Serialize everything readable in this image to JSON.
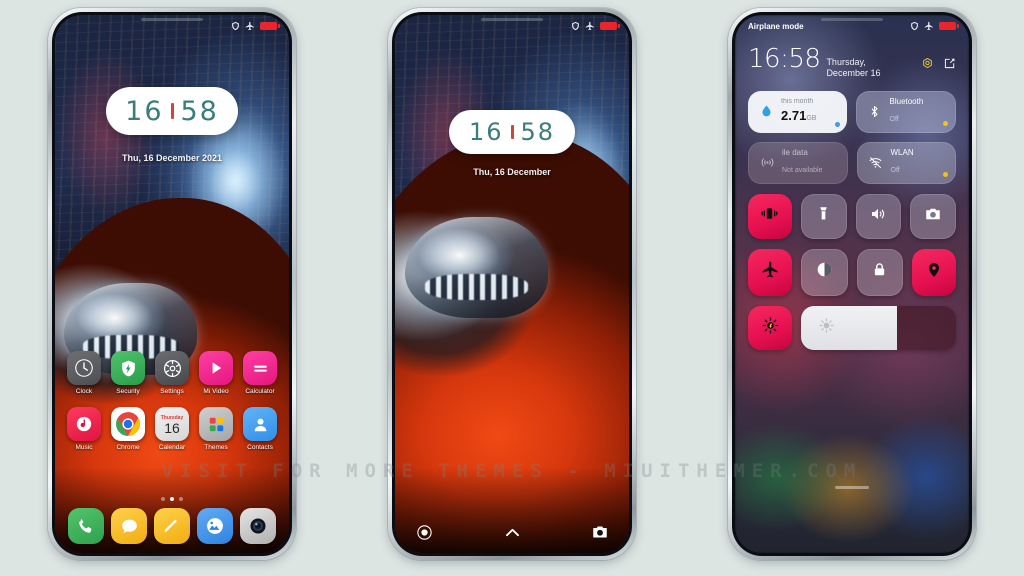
{
  "meta": {
    "background_color": "#dde5e3",
    "accent_pink": "#e61050",
    "clock_teal": "#3b7c7c",
    "clock_sep_red": "#d0453a",
    "watermark": "VISIT FOR MORE THEMES - MIUITHEMER.COM"
  },
  "phone1": {
    "label": "home-screen",
    "statusbar": {
      "shield_icon": "shield-icon",
      "airplane_icon": "airplane-icon",
      "battery_icon": "battery-icon"
    },
    "clock": {
      "hours": "16",
      "minutes": "58"
    },
    "date": "Thu, 16 December 2021",
    "apps_row1": [
      {
        "label": "Clock",
        "icon": "clock-icon"
      },
      {
        "label": "Security",
        "icon": "shield-icon"
      },
      {
        "label": "Settings",
        "icon": "gear-icon"
      },
      {
        "label": "Mi Video",
        "icon": "play-icon"
      },
      {
        "label": "Calculator",
        "icon": "equals-icon"
      }
    ],
    "apps_row2": [
      {
        "label": "Music",
        "icon": "music-note-icon"
      },
      {
        "label": "Chrome",
        "icon": "chrome-icon"
      },
      {
        "label": "Calendar",
        "icon": "calendar-icon",
        "weekday": "Thursday",
        "day": "16"
      },
      {
        "label": "Themes",
        "icon": "themes-grid-icon"
      },
      {
        "label": "Contacts",
        "icon": "person-icon"
      }
    ],
    "dock": [
      {
        "label": "Phone",
        "icon": "phone-icon"
      },
      {
        "label": "Messages",
        "icon": "message-bubble-icon"
      },
      {
        "label": "Notes",
        "icon": "pencil-icon"
      },
      {
        "label": "Gallery",
        "icon": "photo-icon"
      },
      {
        "label": "Camera",
        "icon": "camera-icon"
      }
    ],
    "page_dots": {
      "count": 3,
      "active_index": 1
    }
  },
  "phone2": {
    "label": "lock-screen",
    "statusbar": {
      "shield_icon": "shield-icon",
      "airplane_icon": "airplane-icon",
      "battery_icon": "battery-icon"
    },
    "clock": {
      "hours": "16",
      "minutes": "58"
    },
    "date": "Thu, 16 December",
    "bottom_bar": [
      {
        "name": "flashlight-button",
        "icon": "circle-dot-icon"
      },
      {
        "name": "unlock-chevron",
        "icon": "chevron-up-icon"
      },
      {
        "name": "camera-button",
        "icon": "camera-icon"
      }
    ]
  },
  "phone3": {
    "label": "control-center",
    "statusbar": {
      "left_text": "Airplane mode",
      "shield_icon": "shield-icon",
      "airplane_icon": "airplane-icon",
      "battery_icon": "battery-icon"
    },
    "clock": "16:58",
    "date": "Thursday, December 16",
    "header_icons": [
      {
        "name": "settings-gear-icon",
        "icon": "gear-icon"
      },
      {
        "name": "edit-tiles-icon",
        "icon": "edit-square-icon"
      }
    ],
    "tiles_row1": [
      {
        "name": "data-usage-tile",
        "style": "light",
        "icon": "water-drop-icon",
        "title": "this month",
        "value": "2.71",
        "unit": "GB",
        "dot_color": "#3c9ae8"
      },
      {
        "name": "bluetooth-tile",
        "style": "glass",
        "icon": "bluetooth-icon",
        "title": "Bluetooth",
        "sub": "Off",
        "dot_color": "#f0c419"
      }
    ],
    "tiles_row2": [
      {
        "name": "mobile-data-tile",
        "style": "dim",
        "icon": "signal-icon",
        "title": "ile data",
        "sub": "Not available",
        "dot_color": ""
      },
      {
        "name": "wlan-tile",
        "style": "glass2",
        "icon": "wifi-off-icon",
        "title": "WLAN",
        "sub": "Off",
        "dot_color": "#f0c419"
      }
    ],
    "toggles_row1": [
      {
        "name": "vibrate-toggle",
        "icon": "vibrate-icon",
        "state": "on"
      },
      {
        "name": "flashlight-toggle",
        "icon": "flashlight-icon",
        "state": "off"
      },
      {
        "name": "volume-toggle",
        "icon": "speaker-icon",
        "state": "off"
      },
      {
        "name": "screenshot-toggle",
        "icon": "camera-icon",
        "state": "off"
      }
    ],
    "toggles_row2": [
      {
        "name": "airplane-toggle",
        "icon": "airplane-icon",
        "state": "on"
      },
      {
        "name": "dark-mode-toggle",
        "icon": "contrast-icon",
        "state": "off"
      },
      {
        "name": "screen-lock-toggle",
        "icon": "lock-icon",
        "state": "off"
      },
      {
        "name": "location-toggle",
        "icon": "location-pin-icon",
        "state": "on"
      }
    ],
    "brightness": {
      "button_name": "auto-brightness-button",
      "button_icon": "brightness-icon",
      "slider_name": "brightness-slider",
      "slider_icon": "sun-icon",
      "fill_percent": 62
    },
    "handle": "drag-handle"
  }
}
